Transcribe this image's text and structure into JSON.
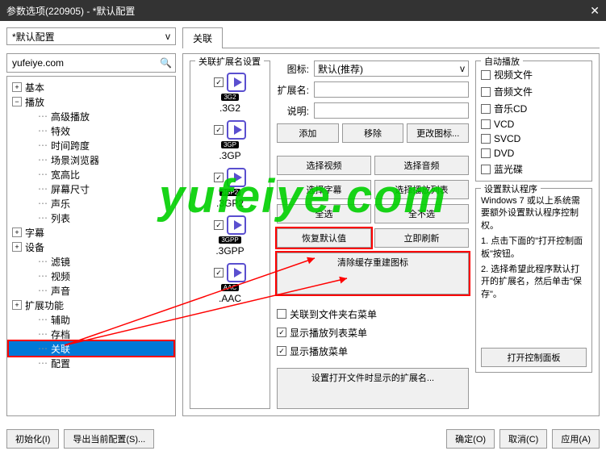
{
  "title": "参数选项(220905) - *默认配置",
  "config_name": "*默认配置",
  "tab_label": "关联",
  "search_value": "yufeiye.com",
  "watermark": "yufeiye.com",
  "tree": {
    "basic": "基本",
    "playback": "播放",
    "playback_children": [
      "高级播放",
      "特效",
      "时间跨度",
      "场景浏览器",
      "宽高比",
      "屏幕尺寸",
      "声乐",
      "列表"
    ],
    "subtitle": "字幕",
    "device": "设备",
    "filter": "滤镜",
    "video": "视频",
    "audio": "声音",
    "extension": "扩展功能",
    "assist": "辅助",
    "archive": "存档",
    "association": "关联",
    "config": "配置"
  },
  "ext_group_title": "关联扩展名设置",
  "extensions": [
    ".3G2",
    ".3GP",
    ".3GP2",
    ".3GPP",
    ".AAC"
  ],
  "form": {
    "icon_label": "图标:",
    "icon_value": "默认(推荐)",
    "ext_label": "扩展名:",
    "desc_label": "说明:"
  },
  "buttons": {
    "add": "添加",
    "remove": "移除",
    "change_icon": "更改图标...",
    "select_video": "选择视频",
    "select_audio": "选择音频",
    "select_sub": "选择字幕",
    "select_playlist": "选择播放列表",
    "select_all": "全选",
    "select_none": "全不选",
    "restore_default": "恢复默认值",
    "refresh_now": "立即刷新",
    "clear_cache": "清除缓存重建图标"
  },
  "context_menu": {
    "folder": "关联到文件夹右菜单",
    "playlist": "显示播放列表菜单",
    "play": "显示播放菜单"
  },
  "open_files_title": "设置打开文件时显示的扩展名...",
  "autoplay": {
    "title": "自动播放",
    "items": [
      "视频文件",
      "音频文件",
      "音乐CD",
      "VCD",
      "SVCD",
      "DVD",
      "蓝光碟"
    ]
  },
  "default_prog": {
    "title": "设置默认程序",
    "desc": "Windows 7 或以上系统需要额外设置默认程序控制权。",
    "step1": "1. 点击下面的\"打开控制面板\"按钮。",
    "step2": "2. 选择希望此程序默认打开的扩展名，然后单击\"保存\"。",
    "open_cp": "打开控制面板"
  },
  "footer": {
    "init": "初始化(I)",
    "export": "导出当前配置(S)...",
    "ok": "确定(O)",
    "cancel": "取消(C)",
    "apply": "应用(A)"
  }
}
